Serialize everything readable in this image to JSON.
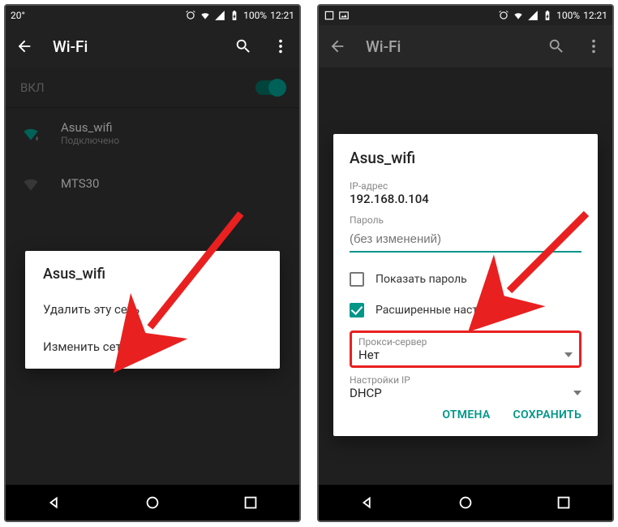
{
  "statusbar": {
    "temp": "20°",
    "battery": "100%",
    "time": "12:21"
  },
  "screen1": {
    "title": "Wi-Fi",
    "toggle_label": "ВКЛ",
    "net1_name": "Asus_wifi",
    "net1_status": "Подключено",
    "net2_name": "MTS30",
    "ctx_title": "Asus_wifi",
    "ctx_forget": "Удалить эту сеть",
    "ctx_modify": "Изменить сеть"
  },
  "screen2": {
    "title": "Wi-Fi",
    "cfg_title": "Asus_wifi",
    "ip_label": "IP-адрес",
    "ip_value": "192.168.0.104",
    "pw_label": "Пароль",
    "pw_placeholder": "(без изменений)",
    "show_pw": "Показать пароль",
    "advanced": "Расширенные настройки",
    "proxy_label": "Прокси-сервер",
    "proxy_value": "Нет",
    "ipcfg_label": "Настройки IP",
    "ipcfg_value": "DHCP",
    "cancel": "ОТМЕНА",
    "save": "СОХРАНИТЬ"
  }
}
